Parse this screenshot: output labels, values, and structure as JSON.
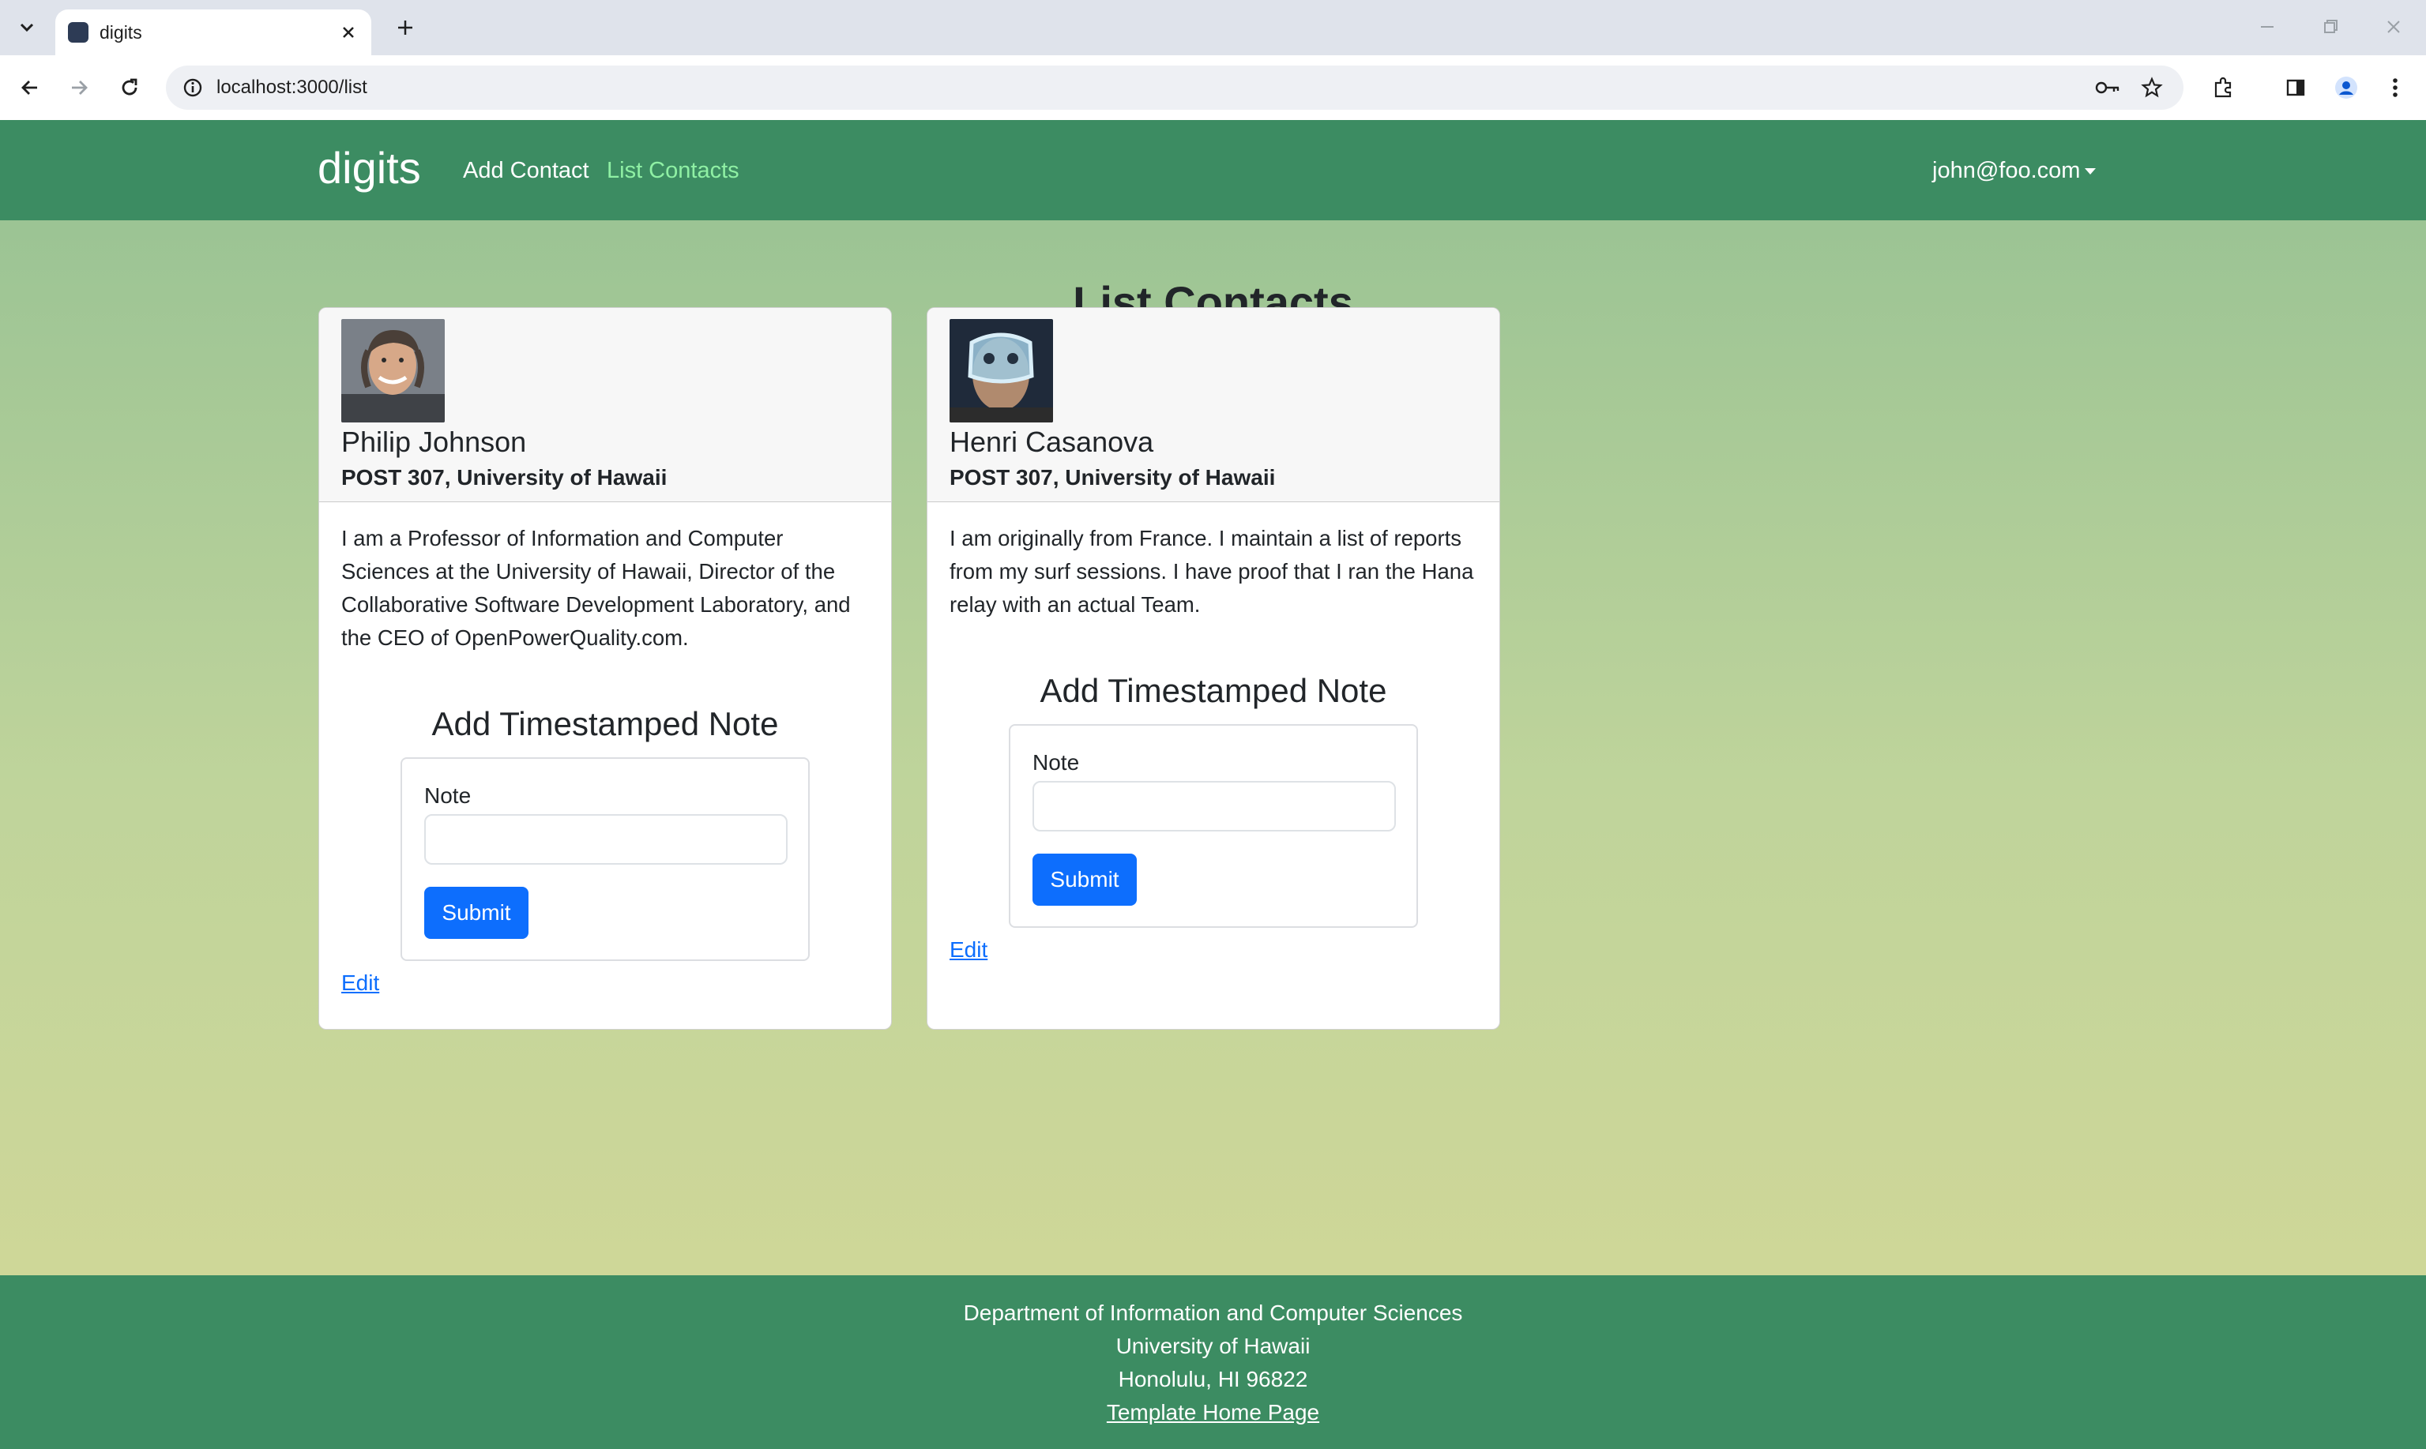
{
  "browser": {
    "tab_title": "digits",
    "url": "localhost:3000/list"
  },
  "navbar": {
    "brand": "digits",
    "links": [
      "Add Contact",
      "List Contacts"
    ],
    "user": "john@foo.com"
  },
  "page": {
    "title": "List Contacts"
  },
  "contacts": [
    {
      "name": "Philip Johnson",
      "address": "POST 307, University of Hawaii",
      "description": "I am a Professor of Information and Computer Sciences at the University of Hawaii, Director of the Collaborative Software Development Laboratory, and the CEO of OpenPowerQuality.com.",
      "note_title": "Add Timestamped Note",
      "note_label": "Note",
      "note_value": "",
      "submit_label": "Submit",
      "edit_label": "Edit"
    },
    {
      "name": "Henri Casanova",
      "address": "POST 307, University of Hawaii",
      "description": "I am originally from France. I maintain a list of reports from my surf sessions. I have proof that I ran the Hana relay with an actual Team.",
      "note_title": "Add Timestamped Note",
      "note_label": "Note",
      "note_value": "",
      "submit_label": "Submit",
      "edit_label": "Edit"
    }
  ],
  "footer": {
    "lines": [
      "Department of Information and Computer Sciences",
      "University of Hawaii",
      "Honolulu, HI 96822"
    ],
    "link": "Template Home Page"
  },
  "colors": {
    "navbar": "#3c8c62",
    "active_link": "#8ff0a4",
    "primary_button": "#0d6efd"
  }
}
